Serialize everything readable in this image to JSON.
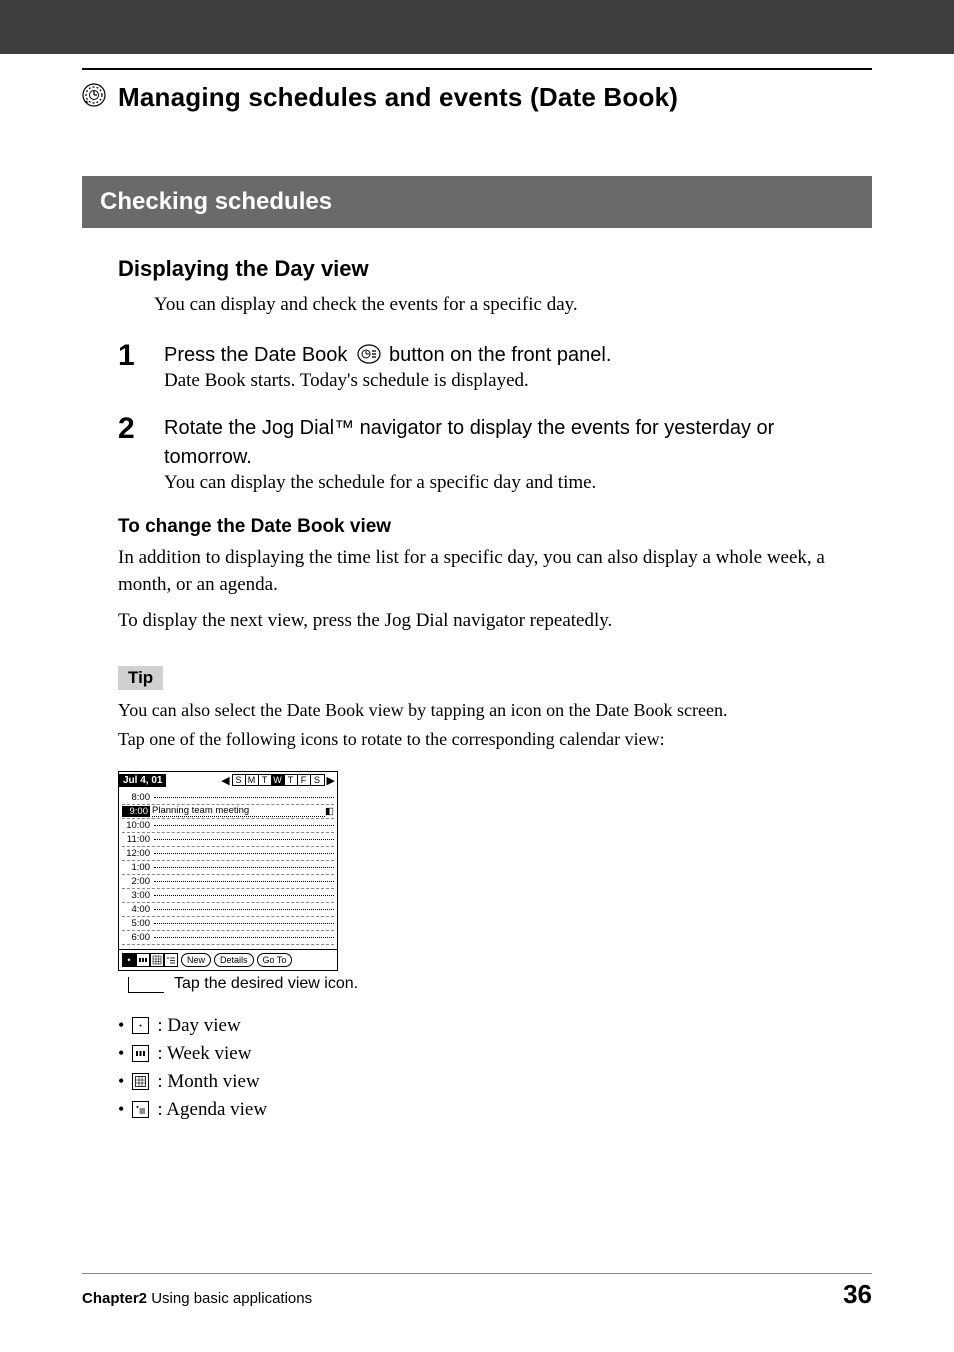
{
  "app_title": "Managing schedules and events (Date Book)",
  "section_title": "Checking schedules",
  "h3": "Displaying the Day view",
  "intro": "You can display and check the events for a specific day.",
  "steps": [
    {
      "num": "1",
      "head_before": "Press the Date Book ",
      "head_after": " button on the front panel.",
      "sub": "Date Book starts. Today's schedule is displayed."
    },
    {
      "num": "2",
      "head_before": "Rotate the Jog Dial™ navigator to display the events for yesterday or tomorrow.",
      "head_after": "",
      "sub": "You can display the schedule for a specific day and time."
    }
  ],
  "h4": "To change the Date Book view",
  "change_para1": "In addition to displaying the time list for a specific day, you can also display a whole week, a month, or an agenda.",
  "change_para2": "To display the next view, press the Jog Dial navigator repeatedly.",
  "tip_label": "Tip",
  "tip_para1": "You can also select the Date Book view by tapping an icon on the Date Book screen.",
  "tip_para2": "Tap one of the following icons to rotate to the corresponding calendar view:",
  "palm": {
    "date": "Jul 4, 01",
    "days": [
      "S",
      "M",
      "T",
      "W",
      "T",
      "F",
      "S"
    ],
    "active_day_index": 3,
    "rows": [
      {
        "t": "8:00",
        "ev": ""
      },
      {
        "t": "9:00",
        "ev": "Planning team meeting",
        "hl": true,
        "note": true
      },
      {
        "t": "10:00",
        "ev": ""
      },
      {
        "t": "11:00",
        "ev": ""
      },
      {
        "t": "12:00",
        "ev": ""
      },
      {
        "t": "1:00",
        "ev": ""
      },
      {
        "t": "2:00",
        "ev": ""
      },
      {
        "t": "3:00",
        "ev": ""
      },
      {
        "t": "4:00",
        "ev": ""
      },
      {
        "t": "5:00",
        "ev": ""
      },
      {
        "t": "6:00",
        "ev": ""
      }
    ],
    "buttons": [
      "New",
      "Details",
      "Go To"
    ]
  },
  "callout": "Tap the desired view icon.",
  "views": [
    {
      "label": ": Day view"
    },
    {
      "label": ": Week view"
    },
    {
      "label": ": Month view"
    },
    {
      "label": ": Agenda view"
    }
  ],
  "footer_chapter_bold": "Chapter2",
  "footer_chapter_rest": "  Using basic applications",
  "page_number": "36"
}
